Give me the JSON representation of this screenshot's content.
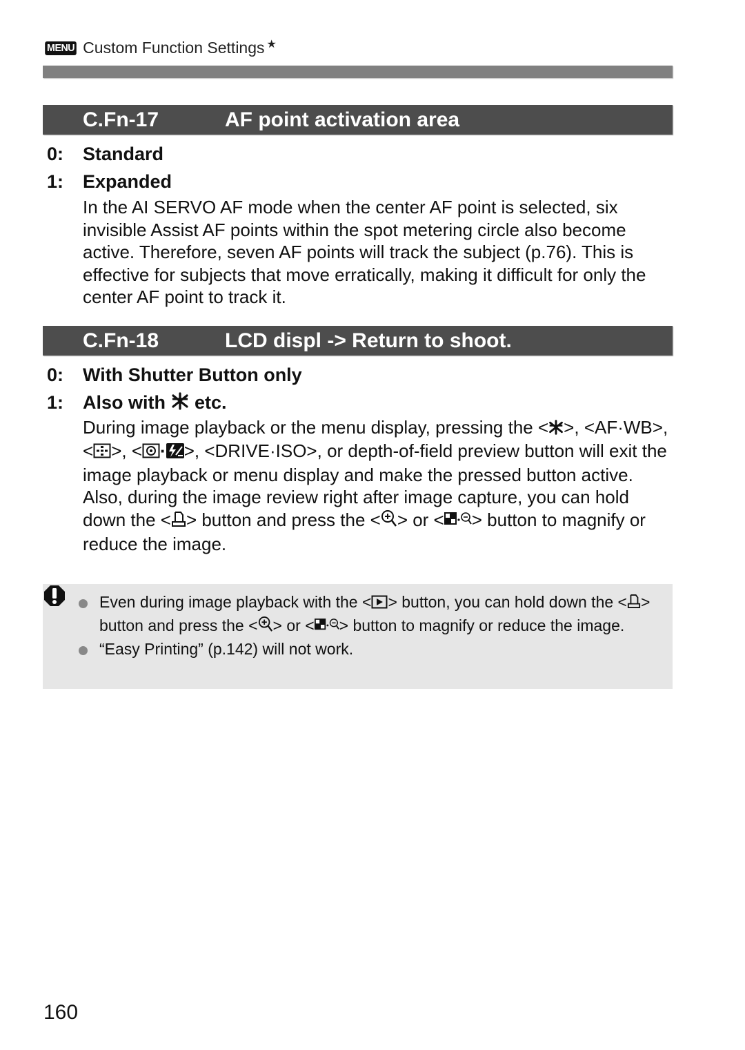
{
  "header": {
    "menu_badge": "MENU",
    "section_title": "Custom Function Settings",
    "star": "★"
  },
  "functions": [
    {
      "code": "C.Fn-17",
      "title": "AF point activation area",
      "options": [
        {
          "num": "0:",
          "label": "Standard"
        },
        {
          "num": "1:",
          "label": "Expanded"
        }
      ],
      "description": "In the AI SERVO AF mode when the center AF point is selected, six invisible Assist AF points within the spot metering circle also become active. Therefore, seven AF points will track the subject (p.76). This is effective for subjects that move erratically, making it difficult for only the center AF point to track it."
    },
    {
      "code": "C.Fn-18",
      "title": "LCD displ -> Return to shoot.",
      "options": [
        {
          "num": "0:",
          "label": "With Shutter Button only"
        },
        {
          "num": "1:",
          "label_before": "Also with",
          "label_icon": "ae-lock-asterisk-icon",
          "label_after": "etc."
        }
      ],
      "description": {
        "p1_a": "During image playback or the menu display, pressing the <",
        "p1_b": ">,",
        "p1_af_wb": "<AF·WB>,",
        "p1_c": "<",
        "p1_d": ">, <",
        "p1_e": ">,",
        "p1_drive_iso": "<DRIVE·ISO>,",
        "p1_f": "or depth-of-field preview button will exit the image playback or menu display and make the pressed button active.",
        "p2_a": "Also, during the image review right after image capture, you can hold down the <",
        "p2_b": "> button and press the <",
        "p2_c": "> or <",
        "p2_d": "> button to magnify or reduce the image."
      }
    }
  ],
  "caution": {
    "icon": "caution-icon",
    "bullets": [
      {
        "a": "Even during image playback with the <",
        "b": "> button, you can hold down the <",
        "c": "> button and press the <",
        "d": "> or <",
        "e": "> button to magnify or reduce the image."
      },
      {
        "text": "“Easy Printing” (p.142) will not work."
      }
    ]
  },
  "page_number": "160"
}
